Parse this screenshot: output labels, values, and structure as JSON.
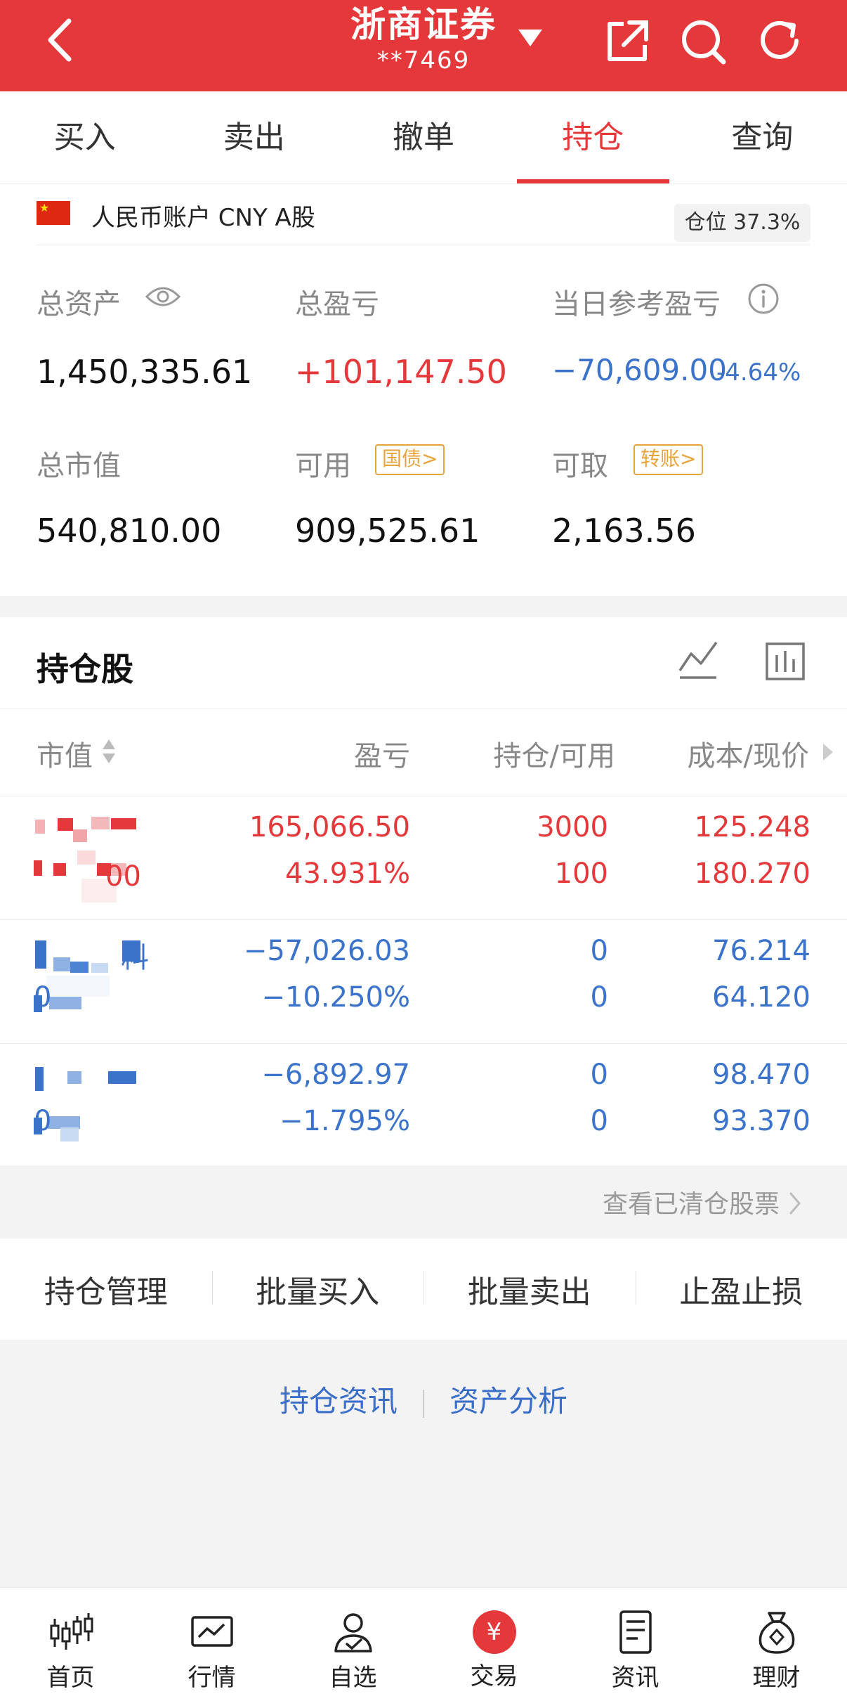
{
  "header": {
    "title": "浙商证券",
    "account": "**7469",
    "background": "#e5383b"
  },
  "tabs": [
    {
      "label": "买入",
      "active": false
    },
    {
      "label": "卖出",
      "active": false
    },
    {
      "label": "撤单",
      "active": false
    },
    {
      "label": "持仓",
      "active": true
    },
    {
      "label": "查询",
      "active": false
    }
  ],
  "account": {
    "label": "人民币账户 CNY A股",
    "position_badge": "仓位 37.3%",
    "total_assets_label": "总资产",
    "total_assets": "1,450,335.61",
    "total_pl_label": "总盈亏",
    "total_pl": "+101,147.50",
    "daily_pl_label": "当日参考盈亏",
    "daily_pl": "−70,609.00",
    "daily_pl_pct": "-4.64%",
    "market_value_label": "总市值",
    "market_value": "540,810.00",
    "available_label": "可用",
    "available_tag": "国债>",
    "available": "909,525.61",
    "withdrawable_label": "可取",
    "withdrawable_tag": "转账>",
    "withdrawable": "2,163.56"
  },
  "holdings": {
    "title": "持仓股",
    "columns": [
      "市值",
      "盈亏",
      "持仓/可用",
      "成本/现价"
    ],
    "rows": [
      {
        "name_fragment": "",
        "code_fragment": "00",
        "pl": "165,066.50",
        "pl_pct": "43.931%",
        "hold": "3000",
        "avail": "100",
        "cost": "125.248",
        "price": "180.270",
        "color": "red"
      },
      {
        "name_fragment": "料",
        "code_fragment": "0",
        "pl": "−57,026.03",
        "pl_pct": "−10.250%",
        "hold": "0",
        "avail": "0",
        "cost": "76.214",
        "price": "64.120",
        "color": "blue"
      },
      {
        "name_fragment": "",
        "code_fragment": "0",
        "pl": "−6,892.97",
        "pl_pct": "−1.795%",
        "hold": "0",
        "avail": "0",
        "cost": "98.470",
        "price": "93.370",
        "color": "blue"
      }
    ],
    "cleared_link": "查看已清仓股票"
  },
  "actions": [
    "持仓管理",
    "批量买入",
    "批量卖出",
    "止盈止损"
  ],
  "links": [
    "持仓资讯",
    "资产分析"
  ],
  "bottom_nav": [
    {
      "label": "首页",
      "icon": "candlestick-icon"
    },
    {
      "label": "行情",
      "icon": "chart-icon"
    },
    {
      "label": "自选",
      "icon": "user-check-icon"
    },
    {
      "label": "交易",
      "icon": "yuan-icon",
      "symbol": "¥"
    },
    {
      "label": "资讯",
      "icon": "document-icon"
    },
    {
      "label": "理财",
      "icon": "money-bag-icon"
    }
  ]
}
